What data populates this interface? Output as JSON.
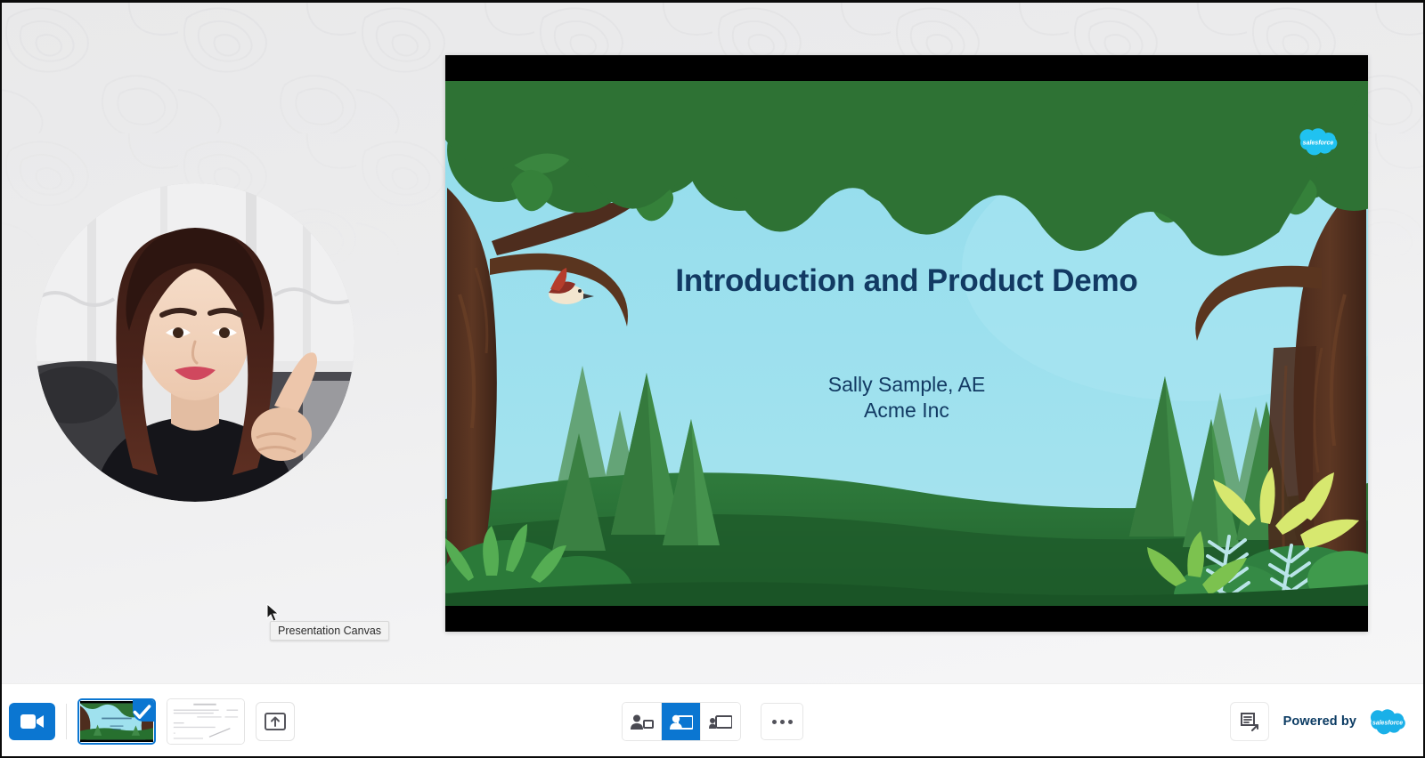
{
  "app": {
    "name": "presentation-canvas-app",
    "accent_color": "#0b76d1",
    "slide_text_color": "#123a63"
  },
  "canvas": {
    "tooltip": "Presentation Canvas",
    "cursor_icon": "mouse-pointer-icon"
  },
  "webcam": {
    "label": "presenter-video-feed"
  },
  "slide": {
    "title": "Introduction and Product Demo",
    "presenter_name": "Sally Sample, AE",
    "company": "Acme Inc",
    "brand_badge": "salesforce",
    "background_theme": "forest-illustration"
  },
  "toolbar": {
    "camera_button": {
      "icon": "video-camera-icon",
      "label": "Camera",
      "active": true
    },
    "thumbnails": [
      {
        "index": 1,
        "name": "slide-thumbnail-forest-title",
        "selected": true,
        "check_icon": "check-icon"
      },
      {
        "index": 2,
        "name": "slide-thumbnail-document",
        "selected": false
      }
    ],
    "upload_button": {
      "icon": "upload-screen-icon",
      "label": "Upload"
    },
    "layout_buttons": [
      {
        "name": "layout-presenter-small",
        "icon": "person-with-small-screen-icon",
        "active": false
      },
      {
        "name": "layout-presenter-overlay",
        "icon": "person-overlay-screen-icon",
        "active": true
      },
      {
        "name": "layout-screen-only",
        "icon": "screen-with-person-icon",
        "active": false
      }
    ],
    "more_button": {
      "name": "more-options-button",
      "icon": "ellipsis-icon",
      "label": "More"
    },
    "notes_button": {
      "name": "notes-popout-button",
      "icon": "notes-popout-icon",
      "label": "Notes"
    },
    "powered_by": {
      "label": "Powered by",
      "brand": "salesforce"
    }
  }
}
